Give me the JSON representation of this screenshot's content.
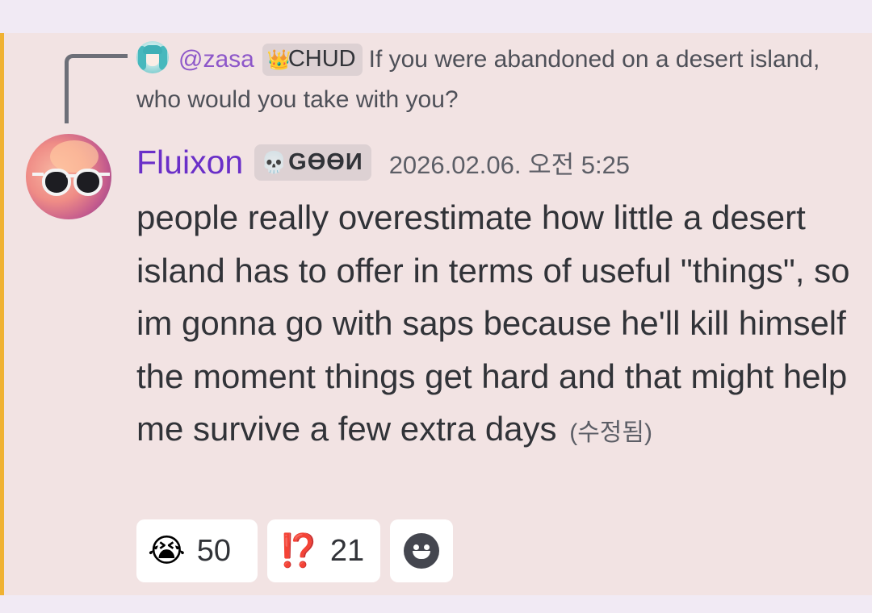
{
  "reply": {
    "username": "@zasa",
    "role_badge": "👑",
    "role_name": "CHUD",
    "text": "If you were abandoned on a desert island, who would you take with you?"
  },
  "message": {
    "author": "Fluixon",
    "role_badge": "💀",
    "role_name": "GϴϴИ",
    "timestamp": "2026.02.06. 오전 5:25",
    "content": "people really overestimate how little a desert island has to offer in terms of useful \"things\", so im gonna go with saps because he'll kill himself the moment things get hard and that might help me survive a few extra days",
    "edited_label": "(수정됨)"
  },
  "reactions": [
    {
      "emoji": "😭",
      "icon": "loudly-crying-face-icon",
      "count": "50"
    },
    {
      "emoji": "⁉️",
      "icon": "interrobang-icon",
      "count": "21"
    }
  ],
  "add_reaction_icon": "smiley-face-icon",
  "colors": {
    "page_background": "#f1eaf4",
    "message_highlight": "#f2e3e3",
    "mention_bar": "#f0b232",
    "author_name": "#6a2fc8",
    "reply_username": "#8d57c9",
    "text": "#313338",
    "muted_text": "#5c5e66"
  }
}
